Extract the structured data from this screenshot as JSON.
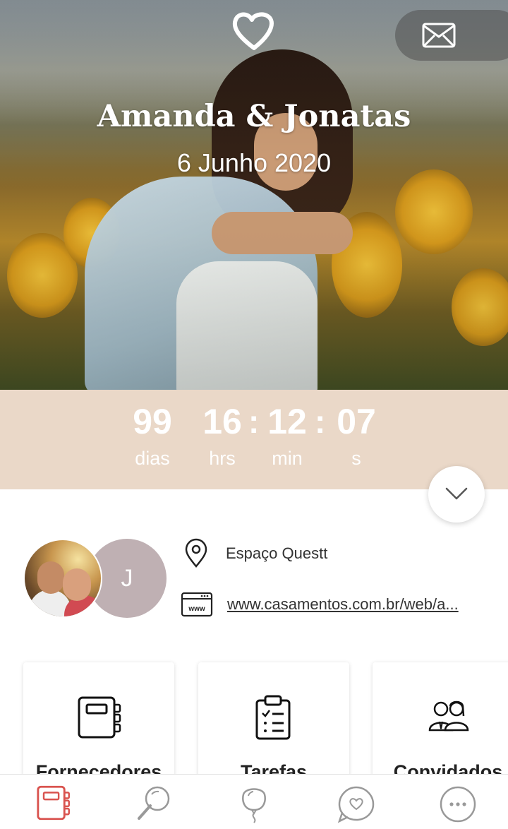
{
  "hero": {
    "names": "Amanda & Jonatas",
    "date": "6 Junho 2020",
    "logo_icon": "heart-icon",
    "mail_icon": "envelope-icon"
  },
  "countdown": {
    "days": "99",
    "days_label": "dias",
    "hours": "16",
    "hours_label": "hrs",
    "minutes": "12",
    "minutes_label": "min",
    "seconds": "07",
    "seconds_label": "s",
    "separator": ":",
    "background": "#ead8c8"
  },
  "profile": {
    "avatar_initial": "J",
    "venue": "Espaço Questt",
    "website": "www.casamentos.com.br/web/a..."
  },
  "cards": [
    {
      "label": "Fornecedores",
      "icon": "notebook-icon"
    },
    {
      "label": "Tarefas",
      "icon": "clipboard-checklist-icon"
    },
    {
      "label": "Convidados",
      "icon": "guests-icon"
    }
  ],
  "bottom_nav": [
    {
      "icon": "notebook-icon",
      "active": true
    },
    {
      "icon": "search-icon",
      "active": false
    },
    {
      "icon": "balloon-icon",
      "active": false
    },
    {
      "icon": "heart-chat-icon",
      "active": false
    },
    {
      "icon": "more-icon",
      "active": false
    }
  ],
  "colors": {
    "accent": "#d9534f",
    "countdown_bg": "#ead8c8",
    "avatar_bg": "#bfb0b3"
  }
}
